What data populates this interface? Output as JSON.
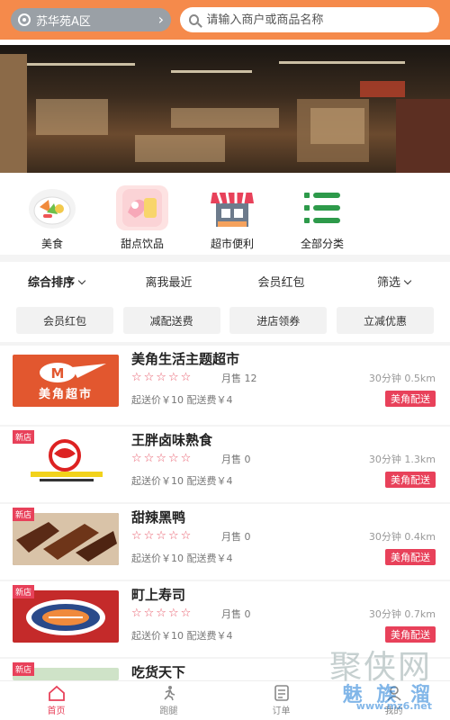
{
  "header": {
    "location": "苏华苑A区",
    "search_placeholder": "请输入商户或商品名称"
  },
  "categories": [
    {
      "label": "美食",
      "icon": "salad-bowl-icon"
    },
    {
      "label": "甜点饮品",
      "icon": "dessert-icon"
    },
    {
      "label": "超市便利",
      "icon": "store-icon"
    },
    {
      "label": "全部分类",
      "icon": "list-icon"
    }
  ],
  "sort": [
    "综合排序",
    "离我最近",
    "会员红包",
    "筛选"
  ],
  "chips": [
    "会员红包",
    "减配送费",
    "进店领券",
    "立减优惠"
  ],
  "stores": [
    {
      "name": "美角生活主题超市",
      "sales": "月售 12",
      "fee": "起送价￥10  配送费￥4",
      "time": "30分钟  0.5km",
      "tag": "美角配送",
      "is_new": false,
      "thumb_text": "美角超市"
    },
    {
      "name": "王胖卤味熟食",
      "sales": "月售 0",
      "fee": "起送价￥10  配送费￥4",
      "time": "30分钟  1.3km",
      "tag": "美角配送",
      "is_new": true,
      "thumb_text": ""
    },
    {
      "name": "甜辣黑鸭",
      "sales": "月售 0",
      "fee": "起送价￥10  配送费￥4",
      "time": "30分钟  0.4km",
      "tag": "美角配送",
      "is_new": true,
      "thumb_text": ""
    },
    {
      "name": "町上寿司",
      "sales": "月售 0",
      "fee": "起送价￥10  配送费￥4",
      "time": "30分钟  0.7km",
      "tag": "美角配送",
      "is_new": true,
      "thumb_text": ""
    },
    {
      "name": "吃货天下",
      "sales": "",
      "fee": "",
      "time": "",
      "tag": "",
      "is_new": true,
      "thumb_text": ""
    }
  ],
  "new_badge": "新店",
  "stars": "☆☆☆☆☆",
  "tabs": [
    {
      "label": "首页",
      "icon": "home-icon"
    },
    {
      "label": "跑腿",
      "icon": "runner-icon"
    },
    {
      "label": "订单",
      "icon": "order-icon"
    },
    {
      "label": "我的",
      "icon": "user-icon"
    }
  ],
  "watermark": {
    "big": "聚侠网",
    "cn": "魅 族 溜",
    "url": "www.mz6.net"
  },
  "colors": {
    "header": "#f58a4b",
    "accent": "#e8415a"
  }
}
